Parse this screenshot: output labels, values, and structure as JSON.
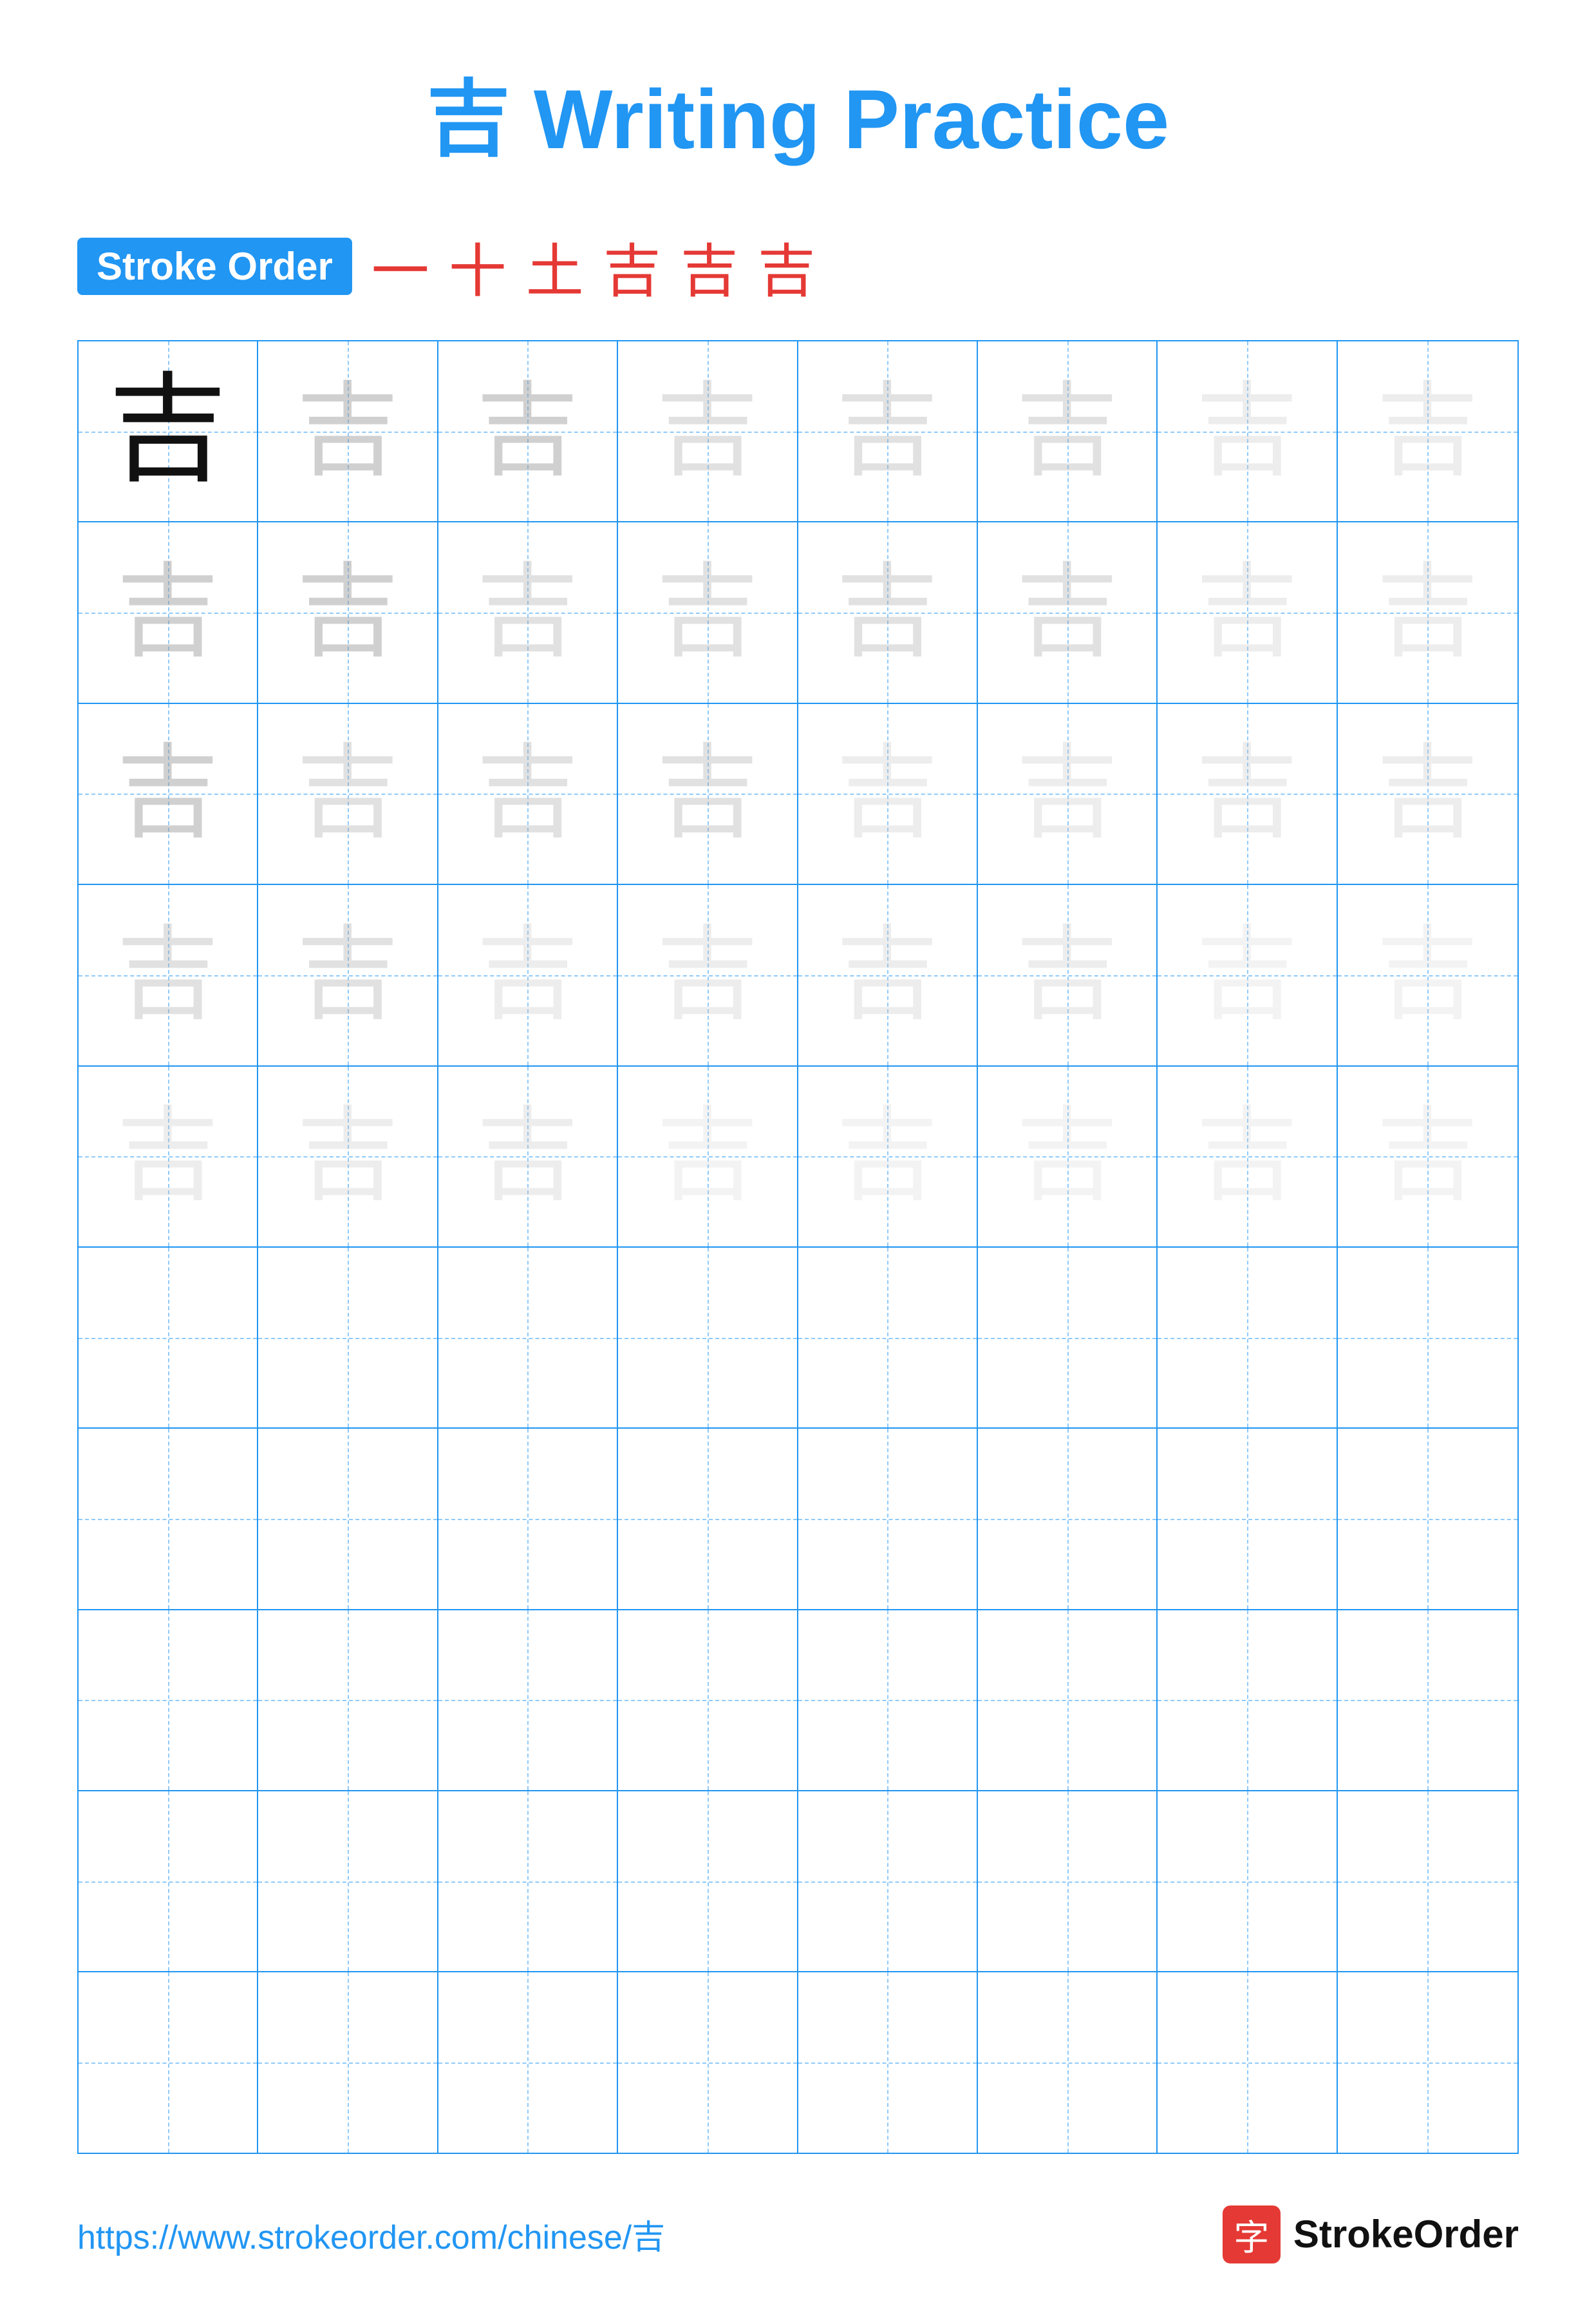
{
  "title": "吉 Writing Practice",
  "stroke_order_label": "Stroke Order",
  "stroke_order_chars": [
    "一",
    "+",
    "土",
    "吉",
    "吉",
    "吉"
  ],
  "character": "吉",
  "grid": {
    "rows": 10,
    "cols": 8,
    "filled_rows": [
      {
        "type": "dark_then_light1",
        "dark_col": 0,
        "light_cols": 7
      },
      {
        "type": "all_light2"
      },
      {
        "type": "all_light2"
      },
      {
        "type": "all_light3"
      },
      {
        "type": "all_light4"
      },
      {
        "type": "empty"
      },
      {
        "type": "empty"
      },
      {
        "type": "empty"
      },
      {
        "type": "empty"
      },
      {
        "type": "empty"
      }
    ]
  },
  "footer": {
    "url": "https://www.strokeorder.com/chinese/吉",
    "brand_char": "字",
    "brand_name": "StrokeOrder"
  }
}
